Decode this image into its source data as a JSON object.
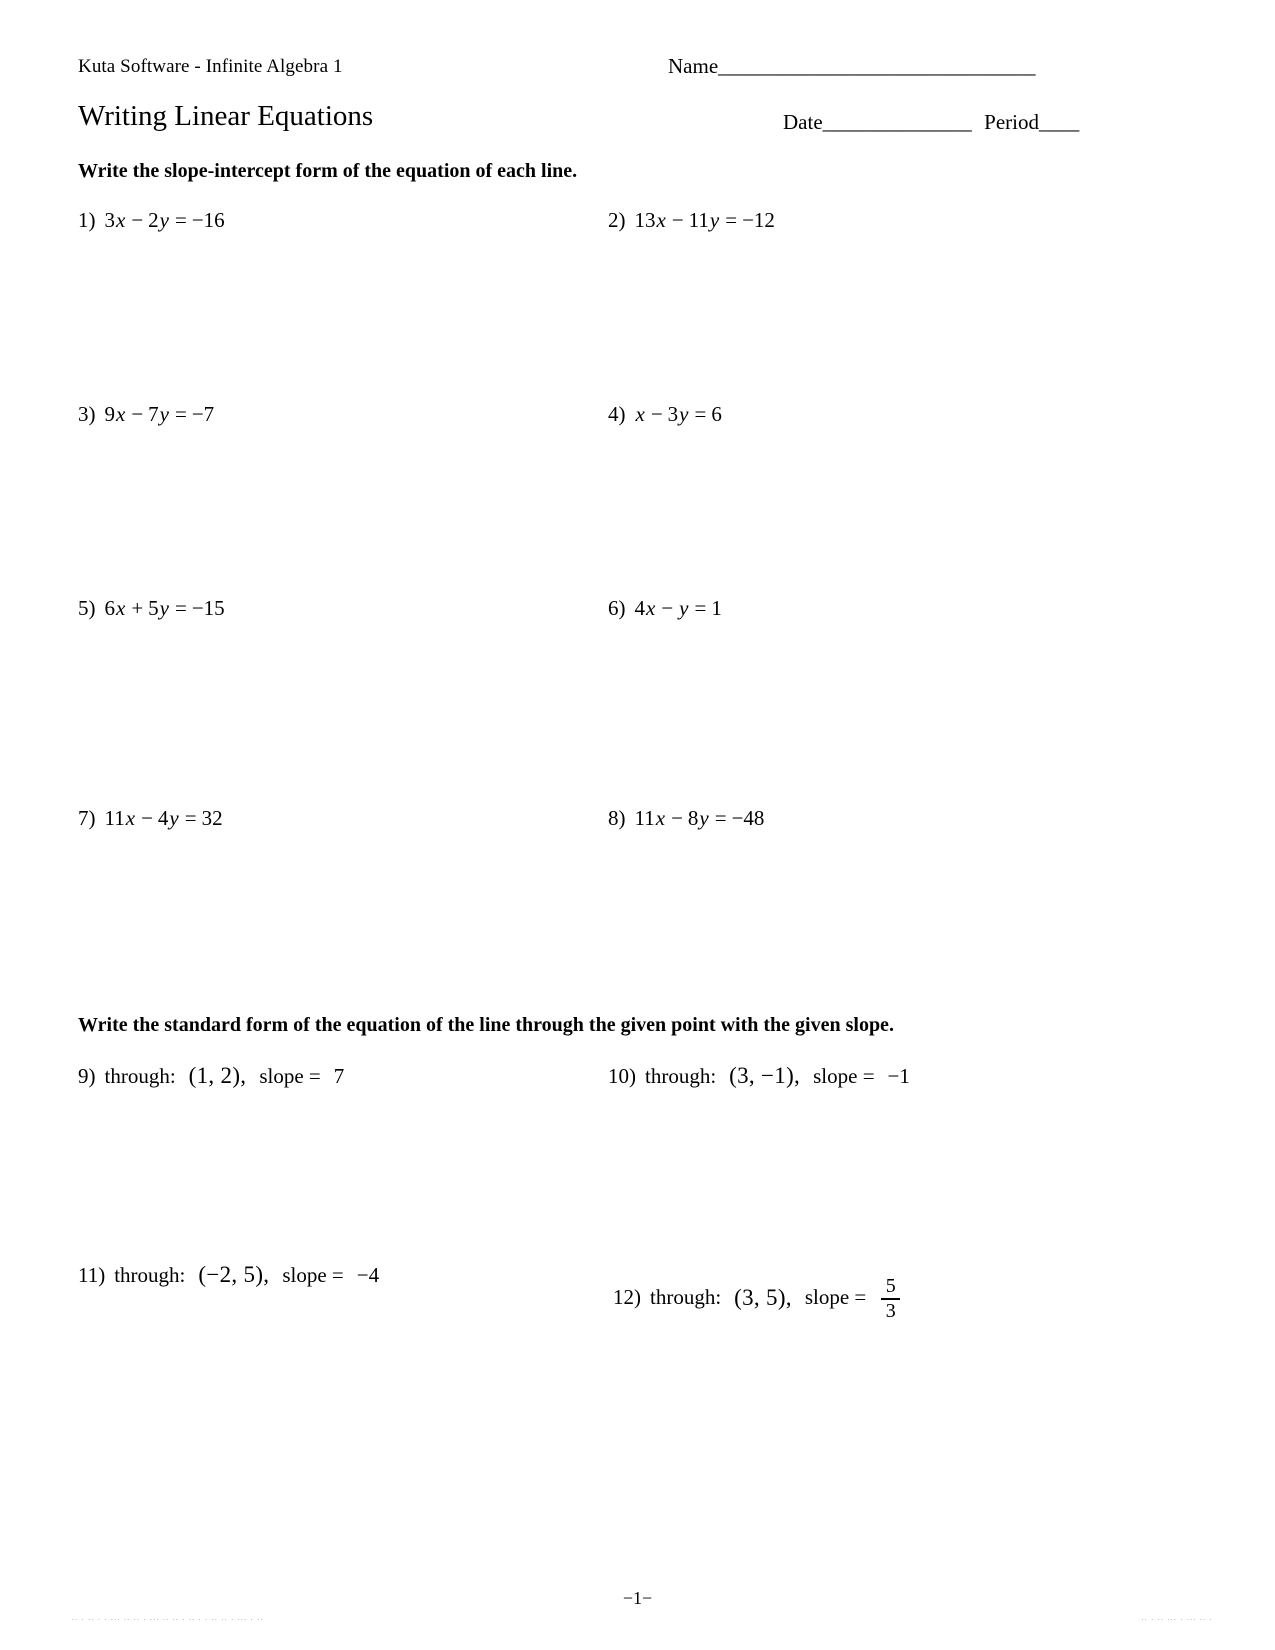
{
  "header": {
    "brand": "Kuta Software - Infinite Algebra 1",
    "title": "Writing Linear Equations",
    "name_label": "Name",
    "name_rule": "________________________________",
    "date_label": "Date",
    "date_rule": "_______________",
    "period_label": "Period",
    "period_rule": "____"
  },
  "sections": [
    {
      "heading": "Write the slope-intercept form of the equation of each line.",
      "problems": [
        {
          "number": "1)",
          "text": "3x − 2y = −16",
          "parts": [
            {
              "t": "3",
              "k": "num"
            },
            {
              "t": "x",
              "k": "var"
            },
            {
              "t": "−",
              "k": "op"
            },
            {
              "t": "2",
              "k": "num"
            },
            {
              "t": "y",
              "k": "var"
            },
            {
              "t": "=",
              "k": "op"
            },
            {
              "t": "−16",
              "k": "num"
            }
          ]
        },
        {
          "number": "2)",
          "text": "13x − 11y = −12",
          "parts": [
            {
              "t": "13",
              "k": "num"
            },
            {
              "t": "x",
              "k": "var"
            },
            {
              "t": "−",
              "k": "op"
            },
            {
              "t": "11",
              "k": "num"
            },
            {
              "t": "y",
              "k": "var"
            },
            {
              "t": "=",
              "k": "op"
            },
            {
              "t": "−12",
              "k": "num"
            }
          ]
        },
        {
          "number": "3)",
          "text": "9x − 7y = −7",
          "parts": [
            {
              "t": "9",
              "k": "num"
            },
            {
              "t": "x",
              "k": "var"
            },
            {
              "t": "−",
              "k": "op"
            },
            {
              "t": "7",
              "k": "num"
            },
            {
              "t": "y",
              "k": "var"
            },
            {
              "t": "=",
              "k": "op"
            },
            {
              "t": "−7",
              "k": "num"
            }
          ]
        },
        {
          "number": "4)",
          "text": "x − 3y = 6",
          "parts": [
            {
              "t": "x",
              "k": "var"
            },
            {
              "t": "−",
              "k": "op"
            },
            {
              "t": "3",
              "k": "num"
            },
            {
              "t": "y",
              "k": "var"
            },
            {
              "t": "=",
              "k": "op"
            },
            {
              "t": "6",
              "k": "num"
            }
          ]
        },
        {
          "number": "5)",
          "text": "6x + 5y = −15",
          "parts": [
            {
              "t": "6",
              "k": "num"
            },
            {
              "t": "x",
              "k": "var"
            },
            {
              "t": "+",
              "k": "op"
            },
            {
              "t": "5",
              "k": "num"
            },
            {
              "t": "y",
              "k": "var"
            },
            {
              "t": "=",
              "k": "op"
            },
            {
              "t": "−15",
              "k": "num"
            }
          ]
        },
        {
          "number": "6)",
          "text": "4x − y = 1",
          "parts": [
            {
              "t": "4",
              "k": "num"
            },
            {
              "t": "x",
              "k": "var"
            },
            {
              "t": "−",
              "k": "op"
            },
            {
              "t": "y",
              "k": "var"
            },
            {
              "t": "=",
              "k": "op"
            },
            {
              "t": "1",
              "k": "num"
            }
          ]
        },
        {
          "number": "7)",
          "text": "11x − 4y = 32",
          "parts": [
            {
              "t": "11",
              "k": "num"
            },
            {
              "t": "x",
              "k": "var"
            },
            {
              "t": "−",
              "k": "op"
            },
            {
              "t": "4",
              "k": "num"
            },
            {
              "t": "y",
              "k": "var"
            },
            {
              "t": "=",
              "k": "op"
            },
            {
              "t": "32",
              "k": "num"
            }
          ]
        },
        {
          "number": "8)",
          "text": "11x − 8y = −48",
          "parts": [
            {
              "t": "11",
              "k": "num"
            },
            {
              "t": "x",
              "k": "var"
            },
            {
              "t": "−",
              "k": "op"
            },
            {
              "t": "8",
              "k": "num"
            },
            {
              "t": "y",
              "k": "var"
            },
            {
              "t": "=",
              "k": "op"
            },
            {
              "t": "−48",
              "k": "num"
            }
          ]
        }
      ]
    },
    {
      "heading": "Write the standard form of the equation of the line through the given point with the given slope.",
      "problems": [
        {
          "number": "9)",
          "text": "through: (1, 2),   slope = 7",
          "through_label": "through:",
          "point": "(1, 2),",
          "slope_label": "slope =",
          "slope_value": "7"
        },
        {
          "number": "10)",
          "text": "through: (3, −1),   slope = −1",
          "through_label": "through:",
          "point": "(3, −1),",
          "slope_label": "slope =",
          "slope_value": "−1"
        },
        {
          "number": "11)",
          "text": "through: (−2, 5),   slope = −4",
          "through_label": "through:",
          "point": "(−2, 5),",
          "slope_label": "slope =",
          "slope_value": "−4"
        },
        {
          "number": "12)",
          "text": "through: (3, 5),   slope = 5/3",
          "through_label": "through:",
          "point": "(3, 5),",
          "slope_label": "slope =",
          "slope_numerator": "5",
          "slope_denominator": "3"
        }
      ]
    }
  ],
  "footer": {
    "page_number": "−1−",
    "noise_left": ".. .  .. .  . ... .. .. . ... .. .. .  .. . .  .. ..  . ...  . ..",
    "noise_right": ".. . .. ... . ... .. ."
  }
}
